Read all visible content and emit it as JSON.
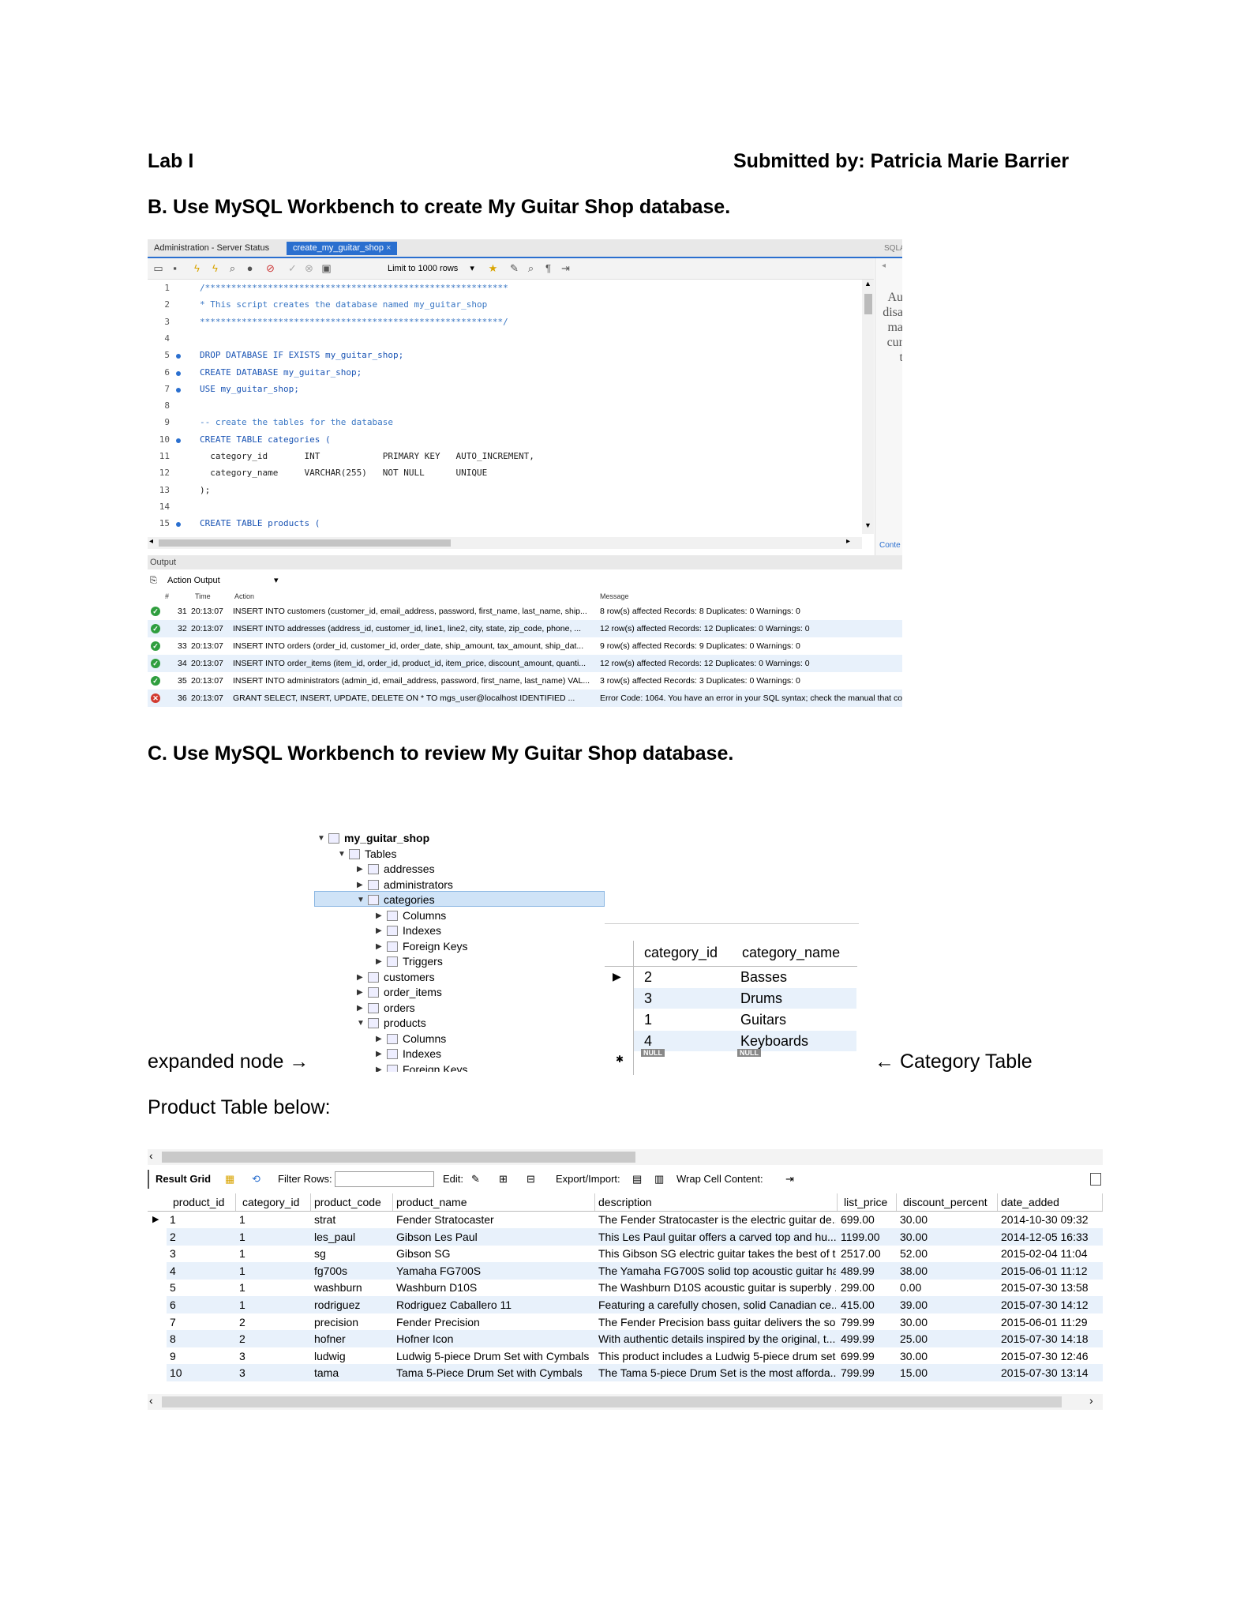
{
  "header": {
    "lab": "Lab I",
    "submitted": "Submitted by: Patricia Marie Barrier"
  },
  "section_b": "B. Use MySQL Workbench to create My Guitar Shop database.",
  "section_c": "C. Use MySQL Workbench to review My Guitar Shop database.",
  "workbench": {
    "tab_admin": "Administration - Server Status",
    "tab_script": "create_my_guitar_shop",
    "tab_side": "SQLAd",
    "limit": "Limit to 1000 rows",
    "side_text": [
      "Au",
      "disa",
      "ma",
      "cur",
      "t"
    ],
    "side_bottom": "Conte",
    "code_lines": [
      {
        "n": "1",
        "dot": false,
        "text": "/**********************************************************",
        "cls": "cm"
      },
      {
        "n": "2",
        "dot": false,
        "text": "* This script creates the database named my_guitar_shop",
        "cls": "cm"
      },
      {
        "n": "3",
        "dot": false,
        "text": "**********************************************************/",
        "cls": "cm"
      },
      {
        "n": "4",
        "dot": false,
        "text": "",
        "cls": ""
      },
      {
        "n": "5",
        "dot": true,
        "text": "DROP DATABASE IF EXISTS my_guitar_shop;",
        "cls": "kw"
      },
      {
        "n": "6",
        "dot": true,
        "text": "CREATE DATABASE my_guitar_shop;",
        "cls": "kw"
      },
      {
        "n": "7",
        "dot": true,
        "text": "USE my_guitar_shop;",
        "cls": "kw"
      },
      {
        "n": "8",
        "dot": false,
        "text": "",
        "cls": ""
      },
      {
        "n": "9",
        "dot": false,
        "text": "-- create the tables for the database",
        "cls": "cm"
      },
      {
        "n": "10",
        "dot": true,
        "text": "CREATE TABLE categories (",
        "cls": "kw"
      },
      {
        "n": "11",
        "dot": false,
        "text": "  category_id       INT            PRIMARY KEY   AUTO_INCREMENT,",
        "cls": ""
      },
      {
        "n": "12",
        "dot": false,
        "text": "  category_name     VARCHAR(255)   NOT NULL      UNIQUE",
        "cls": ""
      },
      {
        "n": "13",
        "dot": false,
        "text": ");",
        "cls": ""
      },
      {
        "n": "14",
        "dot": false,
        "text": "",
        "cls": ""
      },
      {
        "n": "15",
        "dot": true,
        "text": "CREATE TABLE products (",
        "cls": "kw"
      }
    ],
    "output_label": "Output",
    "action_output": "Action Output",
    "col_hash": "#",
    "col_time": "Time",
    "col_action": "Action",
    "col_message": "Message",
    "output_rows": [
      {
        "status": "ok",
        "num": "31",
        "time": "20:13:07",
        "action": "INSERT INTO customers (customer_id, email_address, password, first_name, last_name, ship...",
        "message": "8 row(s) affected Records: 8  Duplicates: 0  Warnings: 0"
      },
      {
        "status": "ok",
        "num": "32",
        "time": "20:13:07",
        "action": "INSERT INTO addresses (address_id, customer_id, line1, line2, city, state, zip_code, phone, ...",
        "message": "12 row(s) affected Records: 12  Duplicates: 0  Warnings: 0"
      },
      {
        "status": "ok",
        "num": "33",
        "time": "20:13:07",
        "action": "INSERT INTO orders (order_id, customer_id, order_date, ship_amount, tax_amount, ship_dat...",
        "message": "9 row(s) affected Records: 9  Duplicates: 0  Warnings: 0"
      },
      {
        "status": "ok",
        "num": "34",
        "time": "20:13:07",
        "action": "INSERT INTO order_items (item_id, order_id, product_id, item_price, discount_amount, quanti...",
        "message": "12 row(s) affected Records: 12  Duplicates: 0  Warnings: 0"
      },
      {
        "status": "ok",
        "num": "35",
        "time": "20:13:07",
        "action": "INSERT INTO administrators (admin_id, email_address, password, first_name, last_name) VAL...",
        "message": "3 row(s) affected Records: 3  Duplicates: 0  Warnings: 0"
      },
      {
        "status": "err",
        "num": "36",
        "time": "20:13:07",
        "action": "GRANT SELECT, INSERT, UPDATE, DELETE ON * TO mgs_user@localhost IDENTIFIED ...",
        "message": "Error Code: 1064. You have an error in your SQL syntax; check the manual that co"
      }
    ]
  },
  "tree": {
    "schema": "my_guitar_shop",
    "tables": "Tables",
    "items": [
      "addresses",
      "administrators",
      "categories",
      "Columns",
      "Indexes",
      "Foreign Keys",
      "Triggers",
      "customers",
      "order_items",
      "orders",
      "products",
      "Columns",
      "Indexes",
      "Foreign Keys"
    ]
  },
  "category_table": {
    "headers": [
      "category_id",
      "category_name"
    ],
    "rows": [
      [
        "2",
        "Basses"
      ],
      [
        "3",
        "Drums"
      ],
      [
        "1",
        "Guitars"
      ],
      [
        "4",
        "Keyboards"
      ]
    ],
    "null_label": "NULL"
  },
  "labels": {
    "expanded_node": "expanded node →",
    "category_table": "← Category Table",
    "product_below": "Product Table below:"
  },
  "product_grid": {
    "toolbar": {
      "result_grid": "Result Grid",
      "filter_rows": "Filter Rows:",
      "edit": "Edit:",
      "export": "Export/Import:",
      "wrap": "Wrap Cell Content:"
    },
    "headers": [
      "product_id",
      "category_id",
      "product_code",
      "product_name",
      "description",
      "list_price",
      "discount_percent",
      "date_added"
    ],
    "rows": [
      [
        "1",
        "1",
        "strat",
        "Fender Stratocaster",
        "The Fender Stratocaster is the electric guitar de...",
        "699.00",
        "30.00",
        "2014-10-30 09:32"
      ],
      [
        "2",
        "1",
        "les_paul",
        "Gibson Les Paul",
        "This Les Paul guitar offers a carved top and hu...",
        "1199.00",
        "30.00",
        "2014-12-05 16:33"
      ],
      [
        "3",
        "1",
        "sg",
        "Gibson SG",
        "This Gibson SG electric guitar takes the best of t...",
        "2517.00",
        "52.00",
        "2015-02-04 11:04"
      ],
      [
        "4",
        "1",
        "fg700s",
        "Yamaha FG700S",
        "The Yamaha FG700S solid top acoustic guitar ha...",
        "489.99",
        "38.00",
        "2015-06-01 11:12"
      ],
      [
        "5",
        "1",
        "washburn",
        "Washburn D10S",
        "The Washburn D10S acoustic guitar is superbly ...",
        "299.00",
        "0.00",
        "2015-07-30 13:58"
      ],
      [
        "6",
        "1",
        "rodriguez",
        "Rodriguez Caballero 11",
        "Featuring a carefully chosen, solid Canadian ce...",
        "415.00",
        "39.00",
        "2015-07-30 14:12"
      ],
      [
        "7",
        "2",
        "precision",
        "Fender Precision",
        "The Fender Precision bass guitar delivers the so...",
        "799.99",
        "30.00",
        "2015-06-01 11:29"
      ],
      [
        "8",
        "2",
        "hofner",
        "Hofner Icon",
        "With authentic details inspired by the original, t...",
        "499.99",
        "25.00",
        "2015-07-30 14:18"
      ],
      [
        "9",
        "3",
        "ludwig",
        "Ludwig 5-piece Drum Set with Cymbals",
        "This product includes a Ludwig 5-piece drum set...",
        "699.99",
        "30.00",
        "2015-07-30 12:46"
      ],
      [
        "10",
        "3",
        "tama",
        "Tama 5-Piece Drum Set with Cymbals",
        "The Tama 5-piece Drum Set is the most afforda...",
        "799.99",
        "15.00",
        "2015-07-30 13:14"
      ]
    ]
  }
}
